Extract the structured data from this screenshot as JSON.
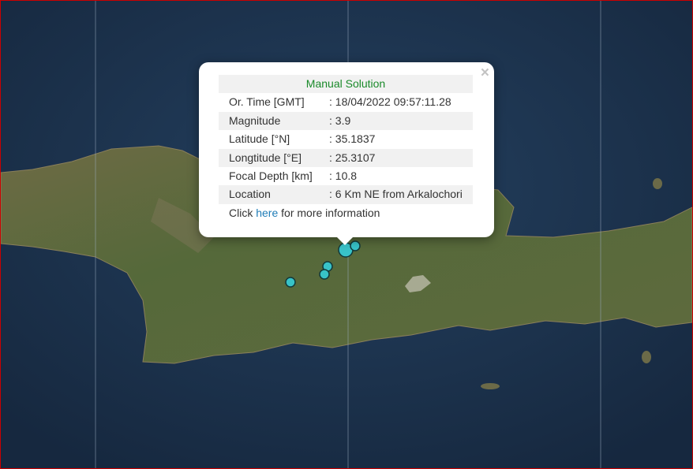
{
  "map": {
    "colors": {
      "sea": "#1c3350",
      "land": "#5b6b38",
      "marker": "#38c3c8",
      "marker_stroke": "#123a3c"
    },
    "markers": [
      {
        "name": "quake-marker-main",
        "size": "large"
      },
      {
        "name": "quake-marker",
        "size": "small"
      },
      {
        "name": "quake-marker",
        "size": "small"
      },
      {
        "name": "quake-marker",
        "size": "small"
      },
      {
        "name": "quake-marker",
        "size": "small"
      }
    ]
  },
  "popup": {
    "title": "Manual Solution",
    "close_icon": "×",
    "rows": [
      {
        "label": "Or. Time [GMT]",
        "value": ": 18/04/2022 09:57:11.28"
      },
      {
        "label": "Magnitude",
        "value": ": 3.9"
      },
      {
        "label": "Latitude [°N]",
        "value": ": 35.1837"
      },
      {
        "label": "Longtitude [°E]",
        "value": ": 25.3107"
      },
      {
        "label": "Focal Depth [km]",
        "value": ": 10.8"
      },
      {
        "label": "Location",
        "value": ": 6 Km NE from Arkalochori"
      }
    ],
    "more": {
      "prefix": "Click ",
      "link": "here",
      "suffix": " for more information"
    }
  }
}
